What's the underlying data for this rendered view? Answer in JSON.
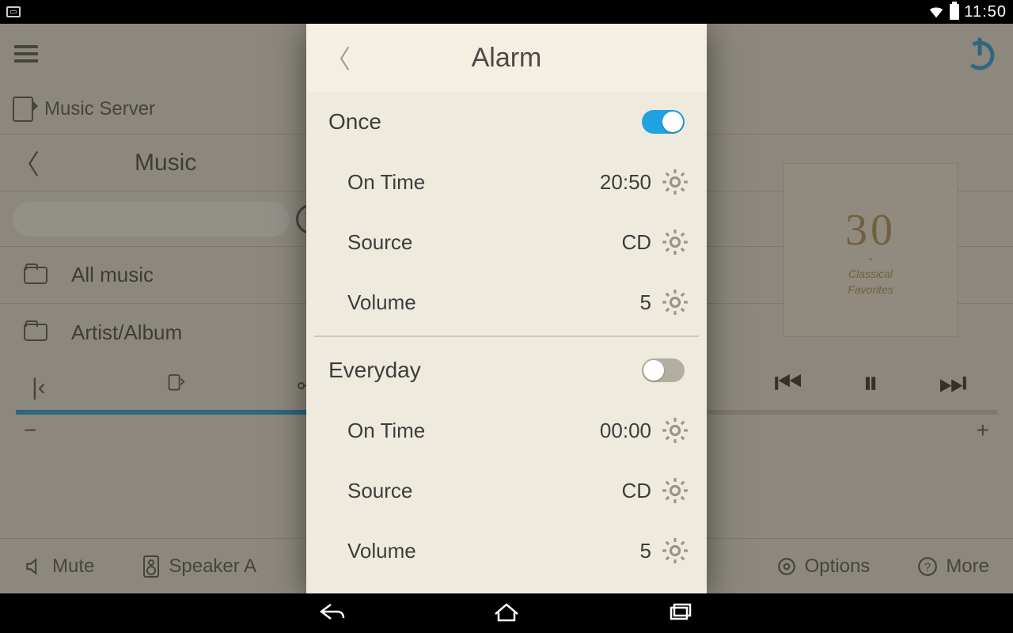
{
  "statusbar": {
    "time": "11:50"
  },
  "app": {
    "breadcrumb": "Music Server",
    "title": "Music",
    "list": [
      {
        "label": "All music"
      },
      {
        "label": "Artist/Album"
      }
    ],
    "bottom": {
      "mute": "Mute",
      "speaker": "Speaker A",
      "options": "Options",
      "more": "More"
    },
    "album": {
      "big": "30",
      "sub1": "Classical",
      "sub2": "Favorites"
    }
  },
  "modal": {
    "title": "Alarm",
    "sections": [
      {
        "name": "Once",
        "enabled": true,
        "rows": [
          {
            "label": "On Time",
            "value": "20:50"
          },
          {
            "label": "Source",
            "value": "CD"
          },
          {
            "label": "Volume",
            "value": "5"
          }
        ]
      },
      {
        "name": "Everyday",
        "enabled": false,
        "rows": [
          {
            "label": "On Time",
            "value": "00:00"
          },
          {
            "label": "Source",
            "value": "CD"
          },
          {
            "label": "Volume",
            "value": "5"
          }
        ]
      }
    ]
  }
}
